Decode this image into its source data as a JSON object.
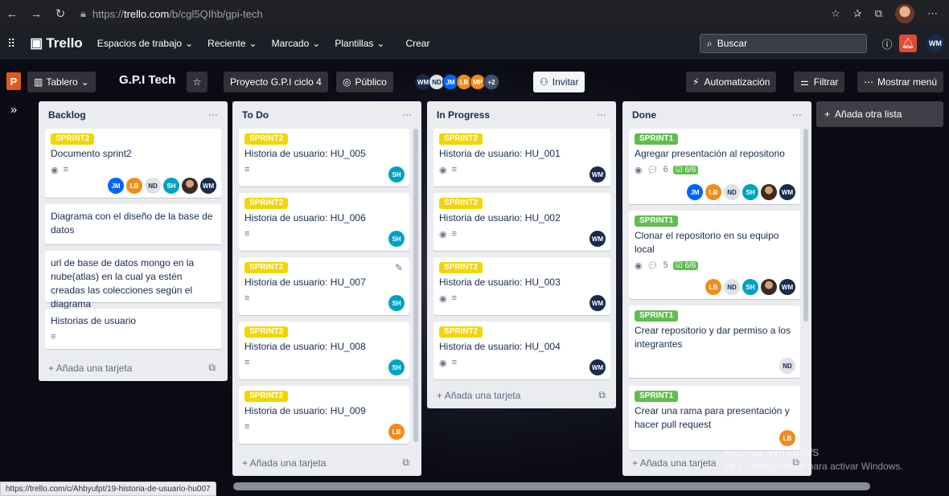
{
  "browser": {
    "url_prefix": "https://",
    "url_domain": "trello.com",
    "url_path": "/b/cgl5QIhb/gpi-tech"
  },
  "topbar": {
    "logo": "Trello",
    "workspaces": "Espacios de trabajo",
    "recent": "Reciente",
    "starred": "Marcado",
    "templates": "Plantillas",
    "create": "Crear",
    "search": "Buscar",
    "user_initials": "WM"
  },
  "board_header": {
    "workspace_initial": "P",
    "view": "Tablero",
    "title": "G.P.I Tech",
    "workspace": "Proyecto G.P.I ciclo 4",
    "visibility": "Público",
    "member_more": "+2",
    "invite": "Invitar",
    "automation": "Automatización",
    "filter": "Filtrar",
    "menu": "Mostrar menú",
    "members": [
      "WM",
      "ND",
      "JM",
      "LB",
      "MP"
    ]
  },
  "lists": [
    {
      "title": "Backlog",
      "add_card": "Añada una tarjeta",
      "cards": [
        {
          "label": "SPRINT2",
          "title": "Documento sprint2",
          "members": [
            "JM",
            "LB",
            "ND",
            "SH",
            "",
            "WM"
          ]
        },
        {
          "title": "Diagrama con el diseño de la base de datos"
        },
        {
          "title": "url de base de datos mongo en la nube(atlas) en la cual ya estén creadas las colecciones según el diagrama"
        },
        {
          "title": "Historias de usuario"
        }
      ]
    },
    {
      "title": "To Do",
      "add_card": "Añada una tarjeta",
      "cards": [
        {
          "label": "SPRINT2",
          "title": "Historia de usuario: HU_005",
          "member": "SH"
        },
        {
          "label": "SPRINT2",
          "title": "Historia de usuario: HU_006",
          "member": "SH"
        },
        {
          "label": "SPRINT2",
          "title": "Historia de usuario: HU_007",
          "member": "SH"
        },
        {
          "label": "SPRINT2",
          "title": "Historia de usuario: HU_008",
          "member": "SH"
        },
        {
          "label": "SPRINT2",
          "title": "Historia de usuario: HU_009",
          "member": "LB"
        }
      ]
    },
    {
      "title": "In Progress",
      "add_card": "Añada una tarjeta",
      "cards": [
        {
          "label": "SPRINT2",
          "title": "Historia de usuario: HU_001",
          "member": "WM"
        },
        {
          "label": "SPRINT2",
          "title": "Historia de usuario: HU_002",
          "member": "WM"
        },
        {
          "label": "SPRINT2",
          "title": "Historia de usuario: HU_003",
          "member": "WM"
        },
        {
          "label": "SPRINT2",
          "title": "Historia de usuario: HU_004",
          "member": "WM"
        }
      ]
    },
    {
      "title": "Done",
      "add_card": "Añada una tarjeta",
      "cards": [
        {
          "label": "SPRINT1",
          "title": "Agregar presentación al repositorio",
          "comments": "6",
          "checklist": "6/6",
          "members": [
            "JM",
            "LB",
            "ND",
            "SH",
            "",
            "WM"
          ]
        },
        {
          "label": "SPRINT1",
          "title": "Clonar el repositorio en su equipo local",
          "comments": "5",
          "checklist": "6/6",
          "members": [
            "LB",
            "ND",
            "SH",
            "",
            "WM"
          ]
        },
        {
          "label": "SPRINT1",
          "title": "Crear repositorio y dar permiso a los integrantes",
          "member": "ND"
        },
        {
          "label": "SPRINT1",
          "title": "Crear una rama para presentación y hacer pull request",
          "member": "LB"
        }
      ]
    }
  ],
  "add_list": "Añada otra lista",
  "status_url": "https://trello.com/c/Ahbyufpt/19-historia-de-usuario-hu007",
  "watermark": {
    "line1": "Activar Windows",
    "line2": "Ve a Configuración para activar Windows."
  },
  "colors": {
    "sprint2": "#f2d600",
    "sprint1": "#61bd4f",
    "topbar": "#1d1f27"
  }
}
